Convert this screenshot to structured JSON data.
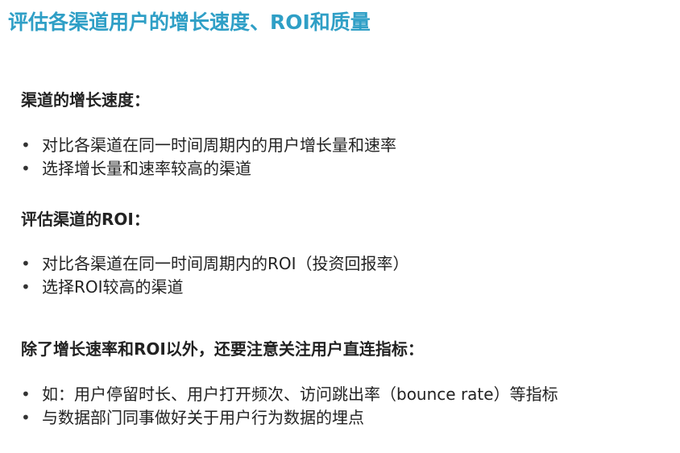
{
  "title": "评估各渠道用户的增长速度、ROI和质量",
  "sections": [
    {
      "heading": "渠道的增长速度：",
      "bullets": [
        "对比各渠道在同一时间周期内的用户增长量和速率",
        "选择增长量和速率较高的渠道"
      ]
    },
    {
      "heading": "评估渠道的ROI：",
      "bullets": [
        "对比各渠道在同一时间周期内的ROI（投资回报率）",
        "选择ROI较高的渠道"
      ]
    },
    {
      "heading": "除了增长速率和ROI以外，还要注意关注用户直连指标：",
      "bullets": [
        "如：用户停留时长、用户打开频次、访问跳出率（bounce rate）等指标",
        "与数据部门同事做好关于用户行为数据的埋点"
      ]
    }
  ],
  "bullet_symbol": "•",
  "colors": {
    "title": "#2f9fc6",
    "text": "#222222"
  }
}
